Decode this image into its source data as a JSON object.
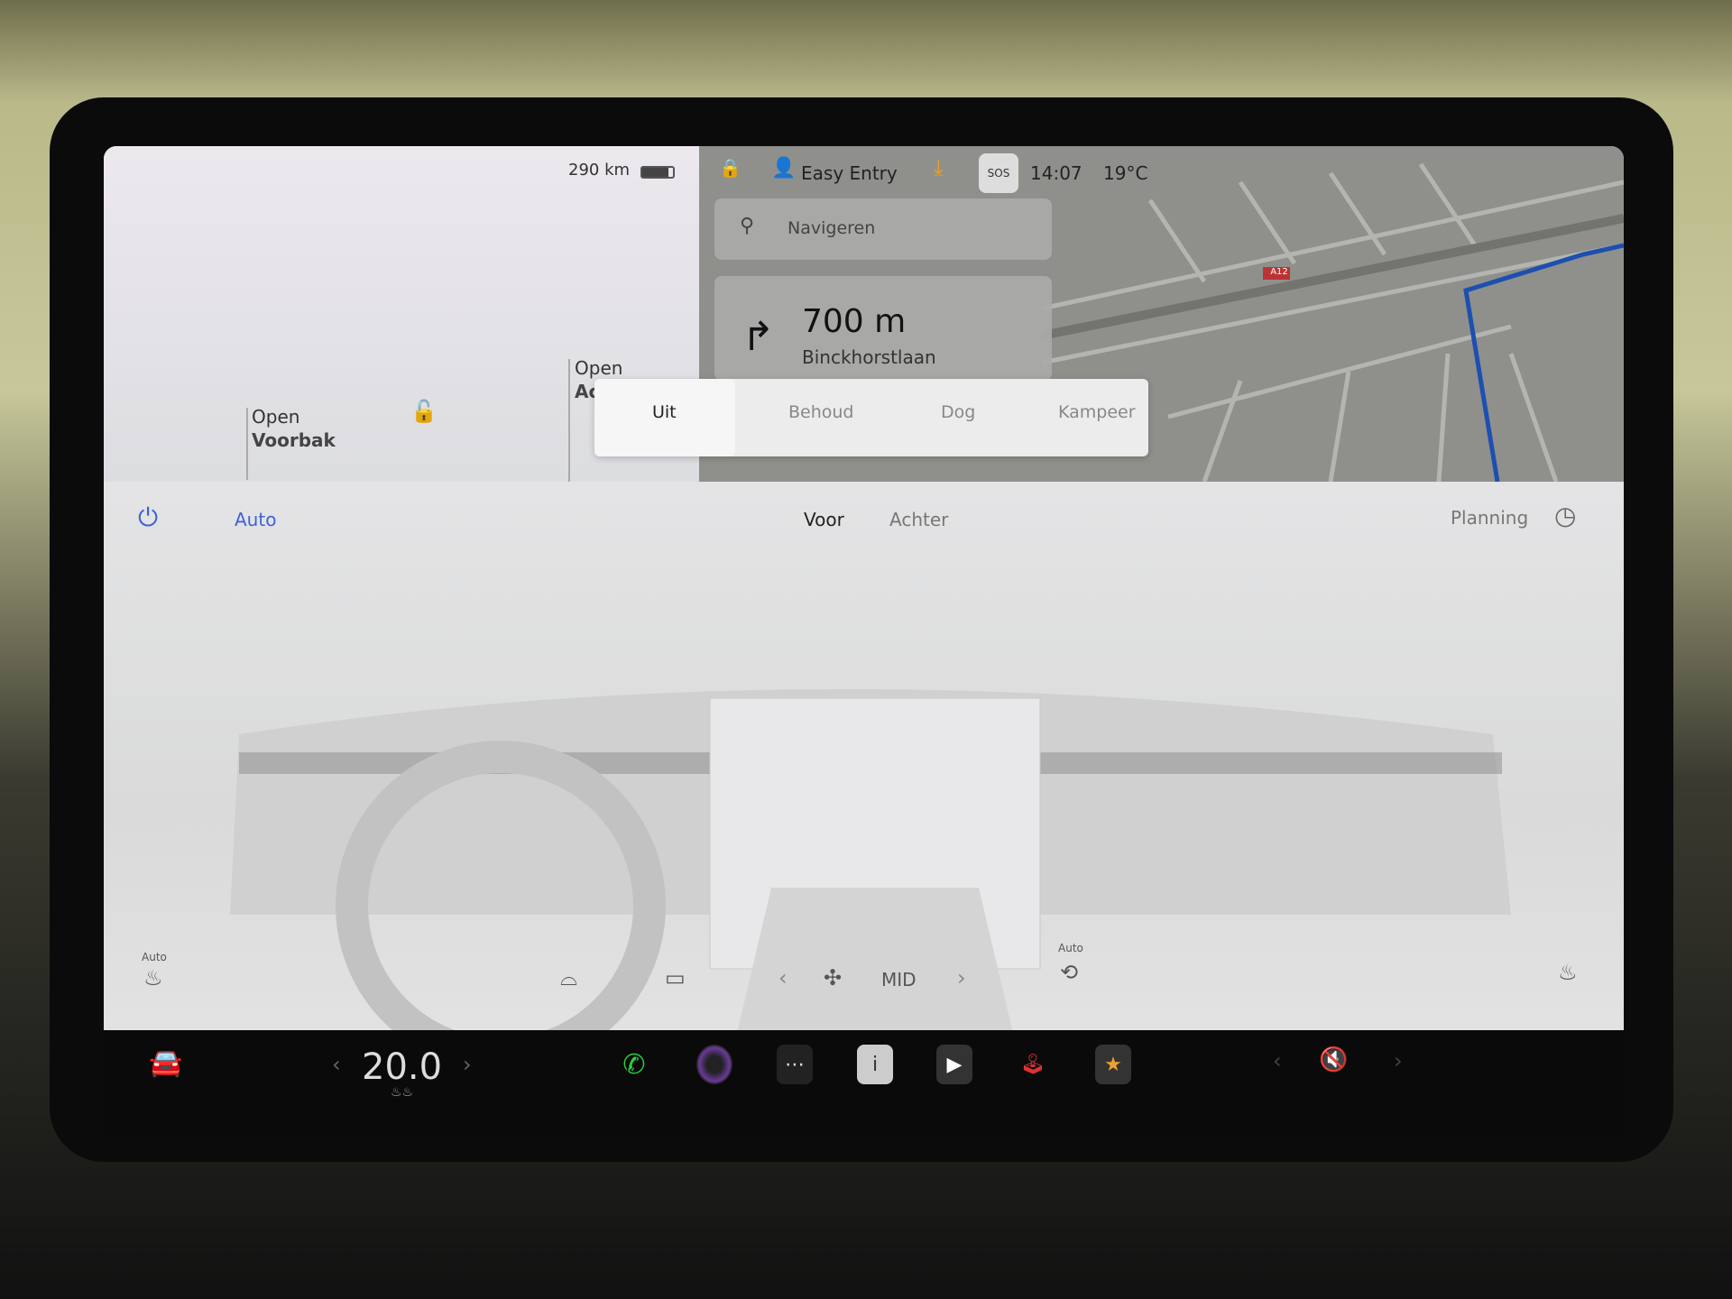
{
  "status_bar": {
    "range": "290 km",
    "profile": "Easy Entry",
    "sos": "SOS",
    "time": "14:07",
    "temperature": "19°C"
  },
  "navigation": {
    "search_placeholder": "Navigeren",
    "turn_distance": "700 m",
    "turn_street": "Binckhorstlaan",
    "road_label": "A12",
    "compass": "NO",
    "route_color": "#1d4fb0"
  },
  "car_panel": {
    "frunk_label_1": "Open",
    "frunk_label_2": "Voorbak",
    "trunk_label_1": "Open",
    "trunk_label_2": "Ac"
  },
  "climate_mode_popup": {
    "options": [
      "Uit",
      "Behoud",
      "Dog",
      "Kampeer"
    ],
    "selected": "Uit"
  },
  "climate": {
    "auto": "Auto",
    "tabs": [
      "Voor",
      "Achter"
    ],
    "active_tab": "Voor",
    "planning": "Planning",
    "fan_speed": "MID",
    "seat_auto": "Auto",
    "recirc_auto": "Auto",
    "accent": "#3e63d6"
  },
  "bottom_bar": {
    "temperature": "20.0",
    "volume": "muted",
    "apps": [
      "phone",
      "camera",
      "more",
      "manual",
      "media",
      "arcade",
      "toybox"
    ]
  }
}
